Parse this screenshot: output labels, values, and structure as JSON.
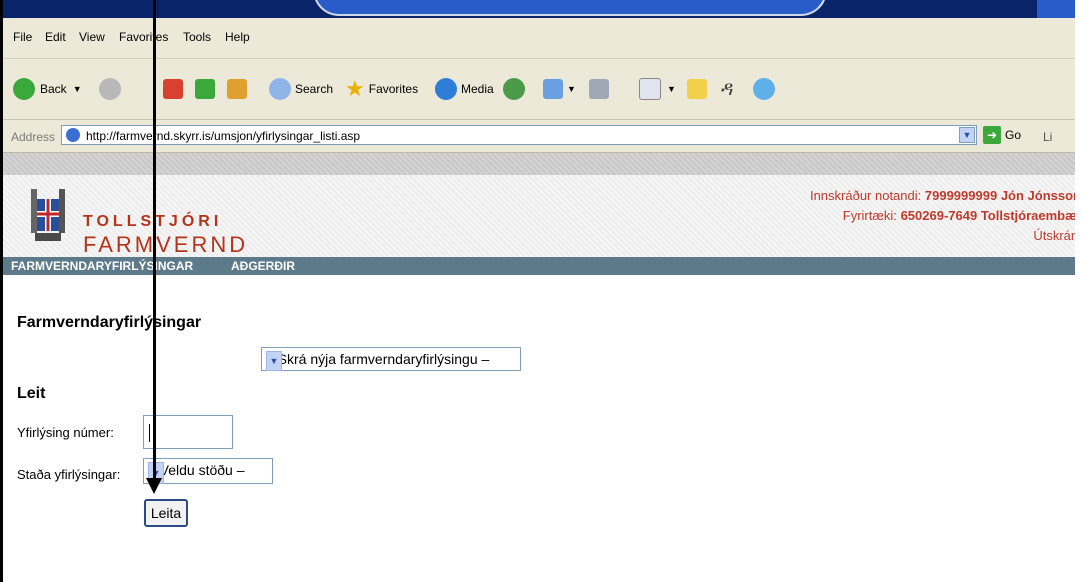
{
  "menu": [
    "File",
    "Edit",
    "View",
    "Favorites",
    "Tools",
    "Help"
  ],
  "toolbar": {
    "back_label": "Back",
    "search_label": "Search",
    "favorites_label": "Favorites",
    "media_label": "Media"
  },
  "address": {
    "label": "Address",
    "url": "http://farmvernd.skyrr.is/umsjon/yfirlysingar_listi.asp",
    "go_label": "Go",
    "links_label": "Li"
  },
  "header": {
    "logo_line1": "TOLLSTJÓRI",
    "logo_line2": "FARMVERND",
    "user_label": "Innskráður notandi:",
    "user_id": "7999999999",
    "user_name": "Jón Jónsson",
    "company_label": "Fyrirtæki:",
    "company_id": "650269-7649",
    "company_name": "Tollstjóraembæt",
    "logout": "Útskráni"
  },
  "nav": [
    "FARMVERNDARYFIRLÝSINGAR",
    "AÐGERÐIR"
  ],
  "main": {
    "title": "Farmverndaryfirlýsingar",
    "new_select": "– Skrá nýja farmverndaryfirlýsingu –",
    "search_heading": "Leit",
    "number_label": "Yfirlýsing númer:",
    "number_value": "",
    "status_label": "Staða yfirlýsingar:",
    "status_select": "– Veldu stöðu –",
    "search_button": "Leita"
  }
}
